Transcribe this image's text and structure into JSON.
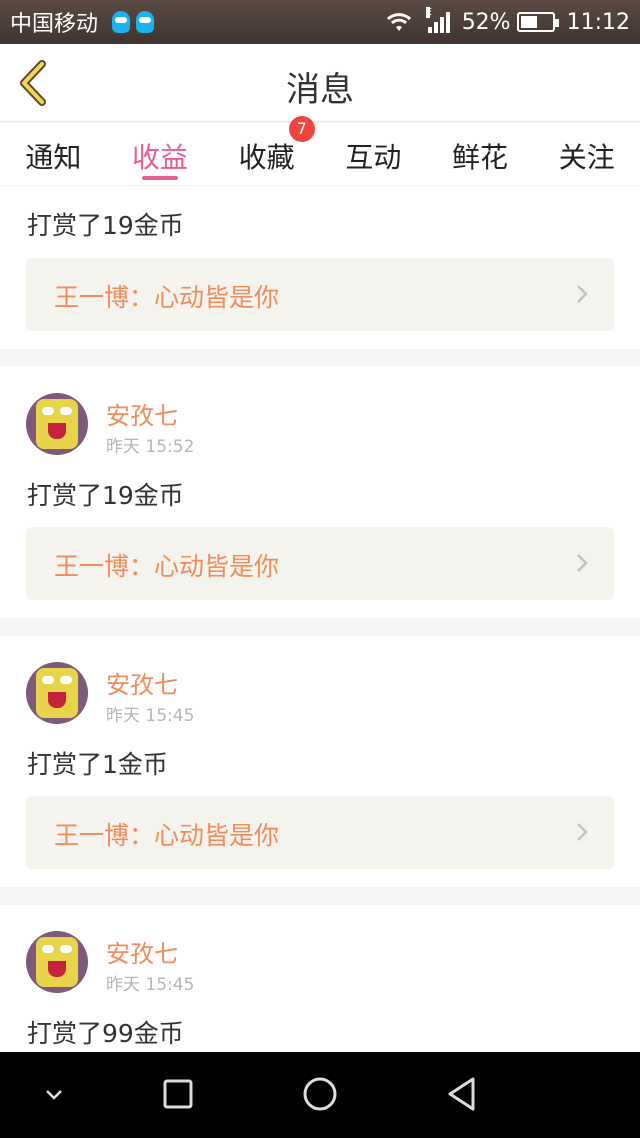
{
  "status_bar": {
    "carrier": "中国移动",
    "network_type": "E",
    "battery": "52%",
    "battery_level": 0.52,
    "time": "11:12"
  },
  "header": {
    "title": "消息"
  },
  "tabs": [
    {
      "label": "通知"
    },
    {
      "label": "收益",
      "active": true
    },
    {
      "label": "收藏",
      "badge": "7"
    },
    {
      "label": "互动"
    },
    {
      "label": "鲜花"
    },
    {
      "label": "关注"
    }
  ],
  "messages": [
    {
      "text": "打赏了19金币",
      "ref": "王一博：心动皆是你"
    },
    {
      "user": "安孜七",
      "time": "昨天 15:52",
      "text": "打赏了19金币",
      "ref": "王一博：心动皆是你"
    },
    {
      "user": "安孜七",
      "time": "昨天 15:45",
      "text": "打赏了1金币",
      "ref": "王一博：心动皆是你"
    },
    {
      "user": "安孜七",
      "time": "昨天 15:45",
      "text": "打赏了99金币"
    }
  ],
  "colors": {
    "accent": "#e95d95",
    "username": "#f18c5d",
    "badge": "#f0453e"
  }
}
